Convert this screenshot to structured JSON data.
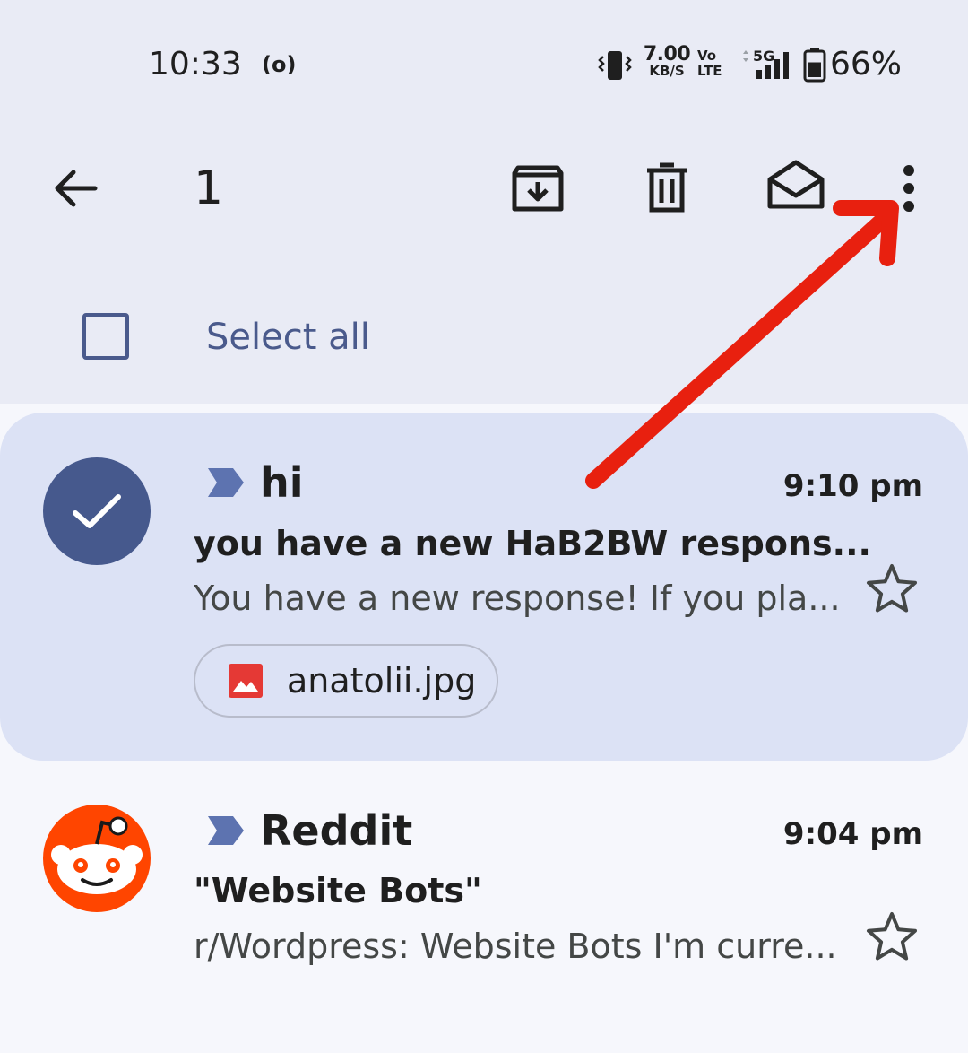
{
  "status_bar": {
    "time": "10:33",
    "hotspot_glyph": "(o)",
    "net_speed_value": "7.00",
    "net_speed_unit": "KB/S",
    "volte_top": "Vo",
    "volte_bottom": "LTE",
    "network": "5G",
    "battery": "66%",
    "battery_level": 0.66
  },
  "toolbar": {
    "selected_count": "1",
    "icons": [
      "back-arrow-icon",
      "archive-icon",
      "delete-icon",
      "mark-read-icon",
      "more-vert-icon"
    ]
  },
  "select_all": {
    "label": "Select all"
  },
  "emails": [
    {
      "sender": "hi",
      "time": "9:10 pm",
      "subject": "you have a new HaB2BW respons...",
      "snippet": "You have a new response! If you pla...",
      "attachment": "anatolii.jpg",
      "selected": true,
      "starred": false
    },
    {
      "sender": "Reddit",
      "time": "9:04 pm",
      "subject": "\"Website Bots\"",
      "snippet": "r/Wordpress: Website Bots I'm curre...",
      "selected": false,
      "starred": false
    }
  ],
  "colors": {
    "header_bg": "#e9ebf5",
    "selected_row_bg": "#dce2f5",
    "list_bg": "#f6f7fc",
    "accent": "#46598d",
    "select_all_text": "#4a5a8c",
    "importance_marker": "#5d73b0",
    "reddit_orange": "#ff4500",
    "annotation_red": "#e8200f"
  }
}
